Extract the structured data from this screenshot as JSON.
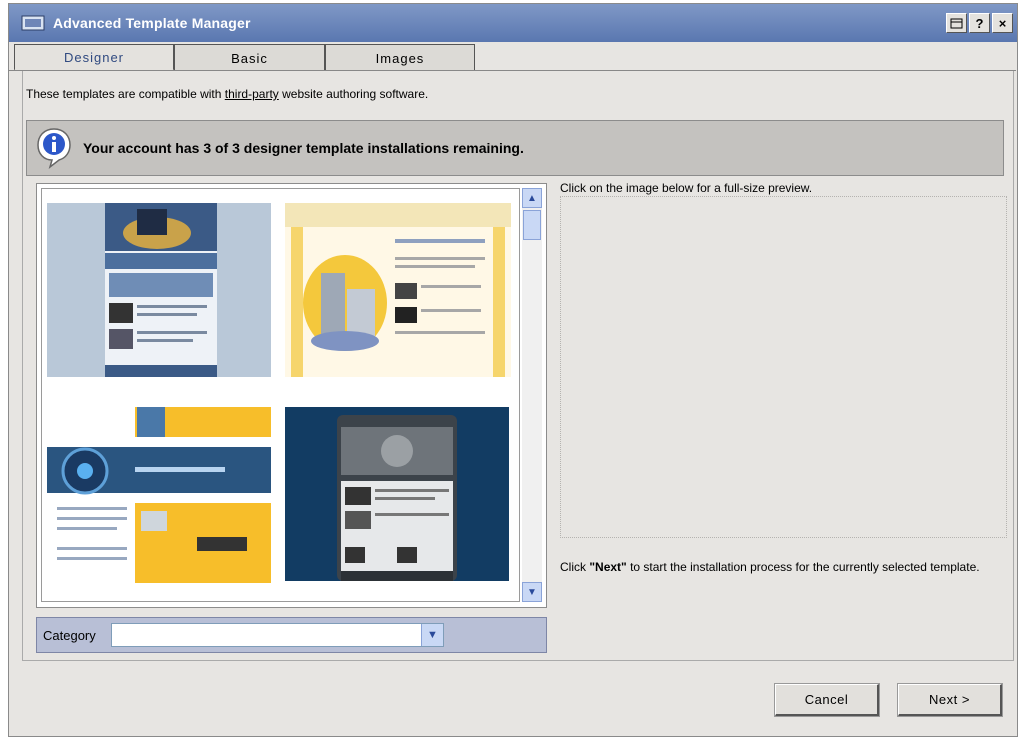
{
  "window": {
    "title": "Advanced Template Manager"
  },
  "titlebar_buttons": {
    "help": "?",
    "close": "×"
  },
  "tabs": [
    {
      "label": "Designer",
      "active": true
    },
    {
      "label": "Basic",
      "active": false
    },
    {
      "label": "Images",
      "active": false
    }
  ],
  "intro": {
    "before": "These templates are compatible with ",
    "link": "third-party",
    "after": " website authoring software."
  },
  "info": {
    "message": "Your account has 3 of 3 designer template installations remaining."
  },
  "gallery": {
    "templates": [
      {
        "name": "template-1",
        "theme": "blue-business"
      },
      {
        "name": "template-2",
        "theme": "yellow-industrial"
      },
      {
        "name": "template-3",
        "theme": "orange-blue-tech"
      },
      {
        "name": "template-4",
        "theme": "dark-security"
      }
    ]
  },
  "category": {
    "label": "Category",
    "value": ""
  },
  "preview": {
    "caption": "Click on the image below for a full-size preview."
  },
  "next_help": {
    "before": "Click ",
    "strong": "\"Next\"",
    "after": " to start the installation process for the currently selected template."
  },
  "buttons": {
    "cancel": "Cancel",
    "next": "Next >"
  },
  "colors": {
    "titlebar": "#5a77b0",
    "active_tab_text": "#304a80",
    "info_bar": "#c4c2bf",
    "category_bar": "#b8bfd6"
  }
}
